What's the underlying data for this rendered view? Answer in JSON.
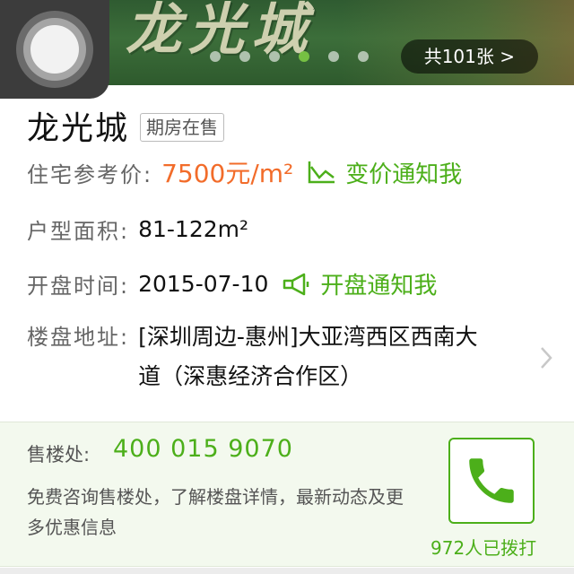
{
  "banner": {
    "background_text": "龙光城",
    "photo_count": "共101张 >",
    "carousel": {
      "total": 6,
      "active_index": 3
    }
  },
  "property": {
    "name": "龙光城",
    "status_badge": "期房在售"
  },
  "price": {
    "label": "住宅参考价:",
    "value": "7500元/m²",
    "notify_label": "变价通知我"
  },
  "area": {
    "label": "户型面积:",
    "value": "81-122m²"
  },
  "opening": {
    "label": "开盘时间:",
    "value": "2015-07-10",
    "notify_label": "开盘通知我"
  },
  "address": {
    "label": "楼盘地址:",
    "value": "[深圳周边-惠州]大亚湾西区西南大道（深惠经济合作区）"
  },
  "sales": {
    "label": "售楼处:",
    "phone": "400 015 9070",
    "description": "免费咨询售楼处，了解楼盘详情，最新动态及更多优惠信息",
    "call_count": "972人已拨打"
  },
  "colors": {
    "accent_green": "#4caf1a",
    "price_orange": "#f26c2a",
    "sales_bg": "#f3f9ee"
  },
  "icons": [
    "assistive-touch-icon",
    "trend-chart-icon",
    "megaphone-icon",
    "chevron-right-icon",
    "phone-icon"
  ]
}
